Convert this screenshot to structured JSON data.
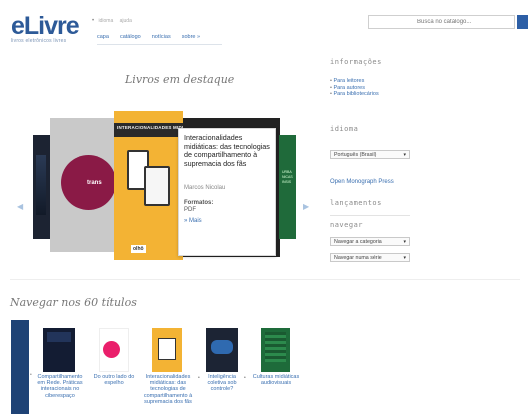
{
  "header": {
    "logo": "eLivre",
    "logo_sub": "livros eletrônicos livres",
    "lang_links": [
      "idioma",
      "ajuda"
    ],
    "nav": [
      "capa",
      "catálogo",
      "notícias",
      "sobre »"
    ],
    "search_placeholder": "Busca no catálogo..."
  },
  "featured": {
    "title": "Livros em destaque",
    "left_arrow": "◀",
    "right_arrow": "▶",
    "main_cover_band": "INTERACIONALIDADES MIDIÁTICAS",
    "main_cover_stamp": "olhō",
    "trans_cover_text": "trans",
    "green_cover_text": "URBA NICAS INSIS",
    "popup": {
      "title": "Interacionalidades midiáticas: das tecnologias de compartilhamento à supremacia dos fãs",
      "author": "Marcos Nicolau",
      "formats_label": "Formatos:",
      "formats": "PDF",
      "more": "» Mais"
    }
  },
  "sidebar": {
    "info_heading": "informações",
    "info_links": [
      "Para leitores",
      "Para autores",
      "Para bibliotecários"
    ],
    "language_heading": "idioma",
    "language_selected": "Português (Brasil)",
    "omp_link": "Open Monograph Press",
    "releases_heading": "lançamentos",
    "browse_heading": "navegar",
    "browse_category": "Navegar a categoria",
    "browse_series": "Navegar numa série"
  },
  "browse": {
    "title": "Navegar nos 60 títulos",
    "books": [
      {
        "caption": "Compartilhamento em Rede. Práticas interacionais no ciberespaço"
      },
      {
        "caption": "Do outro lado do espelho"
      },
      {
        "caption": "Interacionalidades midiáticas: das tecnologias de compartilhamento à supremacia dos fãs"
      },
      {
        "caption": "Inteligência coletiva sob controle?"
      },
      {
        "caption": "Culturas midiáticas audiovisuais"
      }
    ]
  },
  "colors": {
    "brand": "#2d5a98",
    "link": "#3a6fb0",
    "search_button": "#2d5fa6"
  }
}
